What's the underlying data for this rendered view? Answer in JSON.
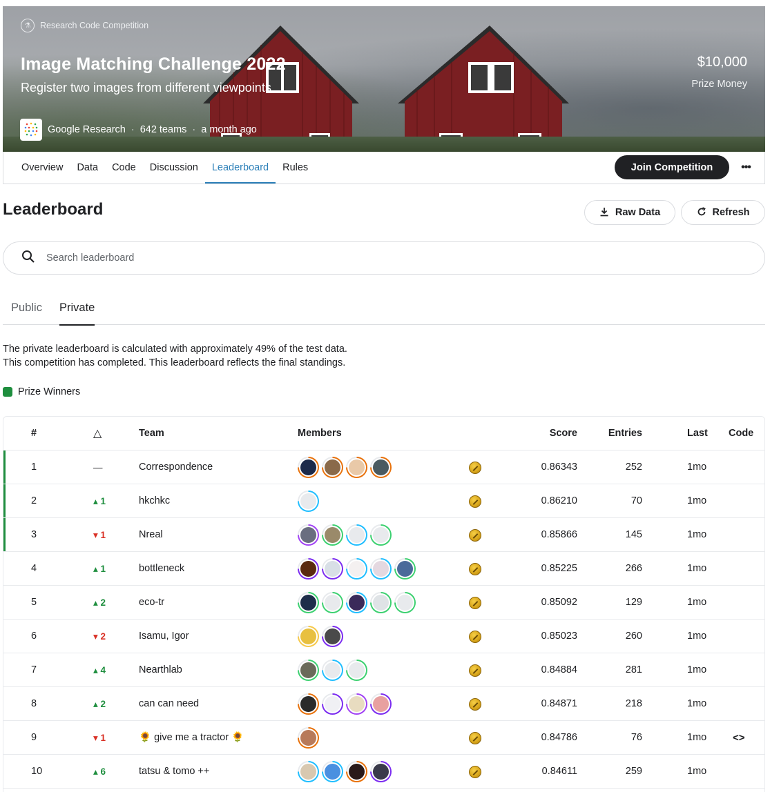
{
  "header": {
    "competition_type": "Research Code Competition",
    "title": "Image Matching Challenge 2022",
    "subtitle": "Register two images from different viewpoints",
    "host": "Google Research",
    "teams": "642 teams",
    "time_ago": "a month ago",
    "prize": "$10,000",
    "prize_label": "Prize Money",
    "separator": "·"
  },
  "nav": {
    "tabs": [
      "Overview",
      "Data",
      "Code",
      "Discussion",
      "Leaderboard",
      "Rules"
    ],
    "active_tab": "Leaderboard",
    "join_label": "Join Competition",
    "more_label": "•••"
  },
  "leaderboard": {
    "title": "Leaderboard",
    "raw_data_label": "Raw Data",
    "refresh_label": "Refresh",
    "search_placeholder": "Search leaderboard",
    "subtabs": [
      "Public",
      "Private"
    ],
    "active_subtab": "Private",
    "note_1": "The private leaderboard is calculated with approximately 49% of the test data.",
    "note_2": "This competition has completed. This leaderboard reflects the final standings.",
    "legend_label": "Prize Winners",
    "columns": {
      "rank": "#",
      "delta": "△",
      "team": "Team",
      "members": "Members",
      "score": "Score",
      "entries": "Entries",
      "last": "Last",
      "code": "Code"
    },
    "rows": [
      {
        "rank": "1",
        "delta": "—",
        "dir": "same",
        "team": "Correspondence",
        "score": "0.86343",
        "entries": "252",
        "last": "1mo",
        "code": "",
        "winner": true,
        "members": [
          {
            "ring": "#e8710a",
            "fill": "#1c2a4a"
          },
          {
            "ring": "#e8710a",
            "fill": "#8a6a4a"
          },
          {
            "ring": "#e8710a",
            "fill": "#e9c9a8"
          },
          {
            "ring": "#e8710a",
            "fill": "#4a5a60"
          }
        ]
      },
      {
        "rank": "2",
        "delta": "1",
        "dir": "up",
        "team": "hkchkc",
        "score": "0.86210",
        "entries": "70",
        "last": "1mo",
        "code": "",
        "winner": true,
        "members": [
          {
            "ring": "#20beff",
            "fill": "#e8eaed"
          }
        ]
      },
      {
        "rank": "3",
        "delta": "1",
        "dir": "down",
        "team": "Nreal",
        "score": "0.85866",
        "entries": "145",
        "last": "1mo",
        "code": "",
        "winner": true,
        "members": [
          {
            "ring": "#a142f4",
            "fill": "#6a6e80"
          },
          {
            "ring": "#3cd070",
            "fill": "#9a8a6a"
          },
          {
            "ring": "#20beff",
            "fill": "#e8eaed"
          },
          {
            "ring": "#3cd070",
            "fill": "#e8eaed"
          }
        ]
      },
      {
        "rank": "4",
        "delta": "1",
        "dir": "up",
        "team": "bottleneck",
        "score": "0.85225",
        "entries": "266",
        "last": "1mo",
        "code": "",
        "winner": false,
        "members": [
          {
            "ring": "#7b2cf0",
            "fill": "#5a2a10"
          },
          {
            "ring": "#7b2cf0",
            "fill": "#d8dfe6"
          },
          {
            "ring": "#20beff",
            "fill": "#f4f0f0"
          },
          {
            "ring": "#20beff",
            "fill": "#e4d8e0"
          },
          {
            "ring": "#3cd070",
            "fill": "#4a6a9a"
          }
        ]
      },
      {
        "rank": "5",
        "delta": "2",
        "dir": "up",
        "team": "eco-tr",
        "score": "0.85092",
        "entries": "129",
        "last": "1mo",
        "code": "",
        "winner": false,
        "members": [
          {
            "ring": "#3cd070",
            "fill": "#1e2d4a"
          },
          {
            "ring": "#3cd070",
            "fill": "#e8eaed"
          },
          {
            "ring": "#20beff",
            "fill": "#3a2a5a"
          },
          {
            "ring": "#3cd070",
            "fill": "#dfe3e6"
          },
          {
            "ring": "#3cd070",
            "fill": "#e8eaed"
          }
        ]
      },
      {
        "rank": "6",
        "delta": "2",
        "dir": "down",
        "team": "Isamu, Igor",
        "score": "0.85023",
        "entries": "260",
        "last": "1mo",
        "code": "",
        "winner": false,
        "members": [
          {
            "ring": "#f6c94a",
            "fill": "#e8c040"
          },
          {
            "ring": "#7b2cf0",
            "fill": "#4a4a4a"
          }
        ]
      },
      {
        "rank": "7",
        "delta": "4",
        "dir": "up",
        "team": "Nearthlab",
        "score": "0.84884",
        "entries": "281",
        "last": "1mo",
        "code": "",
        "winner": false,
        "members": [
          {
            "ring": "#3cd070",
            "fill": "#6a6a5a"
          },
          {
            "ring": "#20beff",
            "fill": "#e8eaed"
          },
          {
            "ring": "#3cd070",
            "fill": "#e8eaed"
          }
        ]
      },
      {
        "rank": "8",
        "delta": "2",
        "dir": "up",
        "team": "can can need",
        "score": "0.84871",
        "entries": "218",
        "last": "1mo",
        "code": "",
        "winner": false,
        "members": [
          {
            "ring": "#e8710a",
            "fill": "#2a2a2a"
          },
          {
            "ring": "#7b2cf0",
            "fill": "#f0f0f4"
          },
          {
            "ring": "#a142f4",
            "fill": "#e8dcc0"
          },
          {
            "ring": "#7b2cf0",
            "fill": "#e8a0a0"
          }
        ]
      },
      {
        "rank": "9",
        "delta": "1",
        "dir": "down",
        "team": "🌻 give me a tractor 🌻",
        "score": "0.84786",
        "entries": "76",
        "last": "1mo",
        "code": "<>",
        "winner": false,
        "members": [
          {
            "ring": "#e8710a",
            "fill": "#b87a5a"
          }
        ]
      },
      {
        "rank": "10",
        "delta": "6",
        "dir": "up",
        "team": "tatsu & tomo ++",
        "score": "0.84611",
        "entries": "259",
        "last": "1mo",
        "code": "",
        "winner": false,
        "members": [
          {
            "ring": "#20beff",
            "fill": "#d8c8b0"
          },
          {
            "ring": "#20beff",
            "fill": "#4a90e0"
          },
          {
            "ring": "#e8710a",
            "fill": "#2a1a1a"
          },
          {
            "ring": "#7b2cf0",
            "fill": "#3a3a4a"
          }
        ]
      }
    ]
  }
}
